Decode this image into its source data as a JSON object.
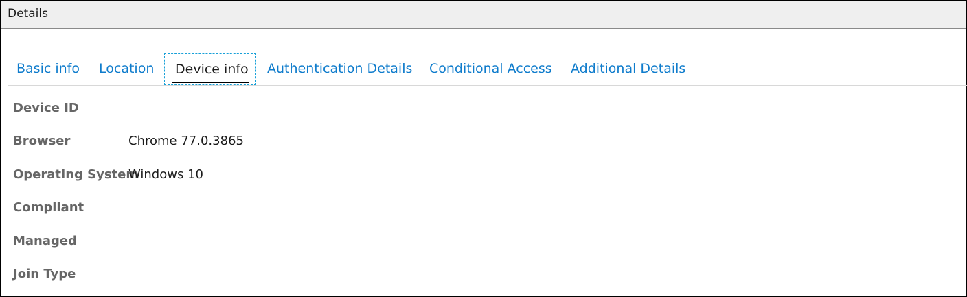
{
  "panel": {
    "title": "Details"
  },
  "tabs": [
    {
      "label": "Basic info",
      "active": false
    },
    {
      "label": "Location",
      "active": false
    },
    {
      "label": "Device info",
      "active": true
    },
    {
      "label": "Authentication Details",
      "active": false
    },
    {
      "label": "Conditional Access",
      "active": false
    },
    {
      "label": "Additional Details",
      "active": false
    }
  ],
  "device_info": [
    {
      "label": "Device ID",
      "value": ""
    },
    {
      "label": "Browser",
      "value": "Chrome 77.0.3865"
    },
    {
      "label": "Operating System",
      "value": "Windows 10"
    },
    {
      "label": "Compliant",
      "value": ""
    },
    {
      "label": "Managed",
      "value": ""
    },
    {
      "label": "Join Type",
      "value": ""
    }
  ],
  "colors": {
    "tab_link": "#0f7ccc",
    "label_gray": "#666666",
    "focus_outline": "#17a0d8",
    "titlebar_bg": "#efefef"
  }
}
